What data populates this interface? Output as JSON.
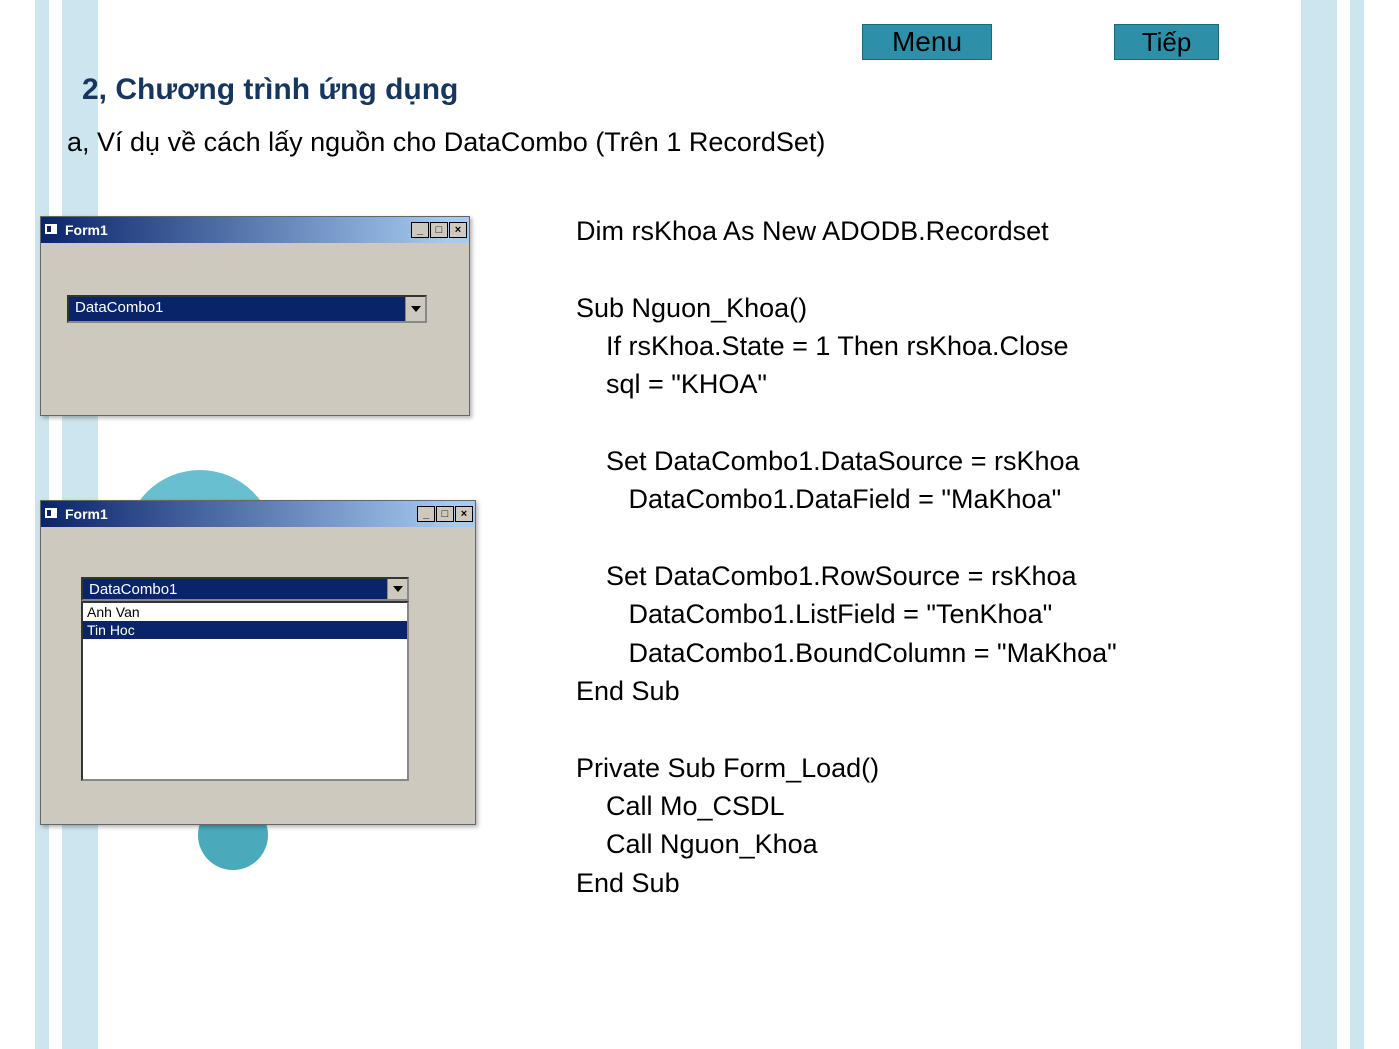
{
  "nav": {
    "menu": "Menu",
    "next": "Tiếp"
  },
  "heading": "2, Chương trình ứng dụng",
  "subheading": "a, Ví dụ về cách lấy nguồn cho DataCombo (Trên 1 RecordSet)",
  "windows": {
    "form1": {
      "title": "Form1",
      "combo_text": "DataCombo1",
      "min_glyph": "_",
      "max_glyph": "□",
      "close_glyph": "×"
    },
    "form2": {
      "title": "Form1",
      "combo_text": "DataCombo1",
      "list": [
        "Anh Van",
        "Tin Hoc"
      ],
      "selected_index": 1,
      "min_glyph": "_",
      "max_glyph": "□",
      "close_glyph": "×"
    }
  },
  "code_lines": [
    "Dim rsKhoa As New ADODB.Recordset",
    "",
    "Sub Nguon_Khoa()",
    "    If rsKhoa.State = 1 Then rsKhoa.Close",
    "    sql = \"KHOA\"",
    "",
    "    Set DataCombo1.DataSource = rsKhoa",
    "       DataCombo1.DataField = \"MaKhoa\"",
    "",
    "    Set DataCombo1.RowSource = rsKhoa",
    "       DataCombo1.ListField = \"TenKhoa\"",
    "       DataCombo1.BoundColumn = \"MaKhoa\"",
    "End Sub",
    "",
    "Private Sub Form_Load()",
    "    Call Mo_CSDL",
    "    Call Nguon_Khoa",
    "End Sub"
  ]
}
